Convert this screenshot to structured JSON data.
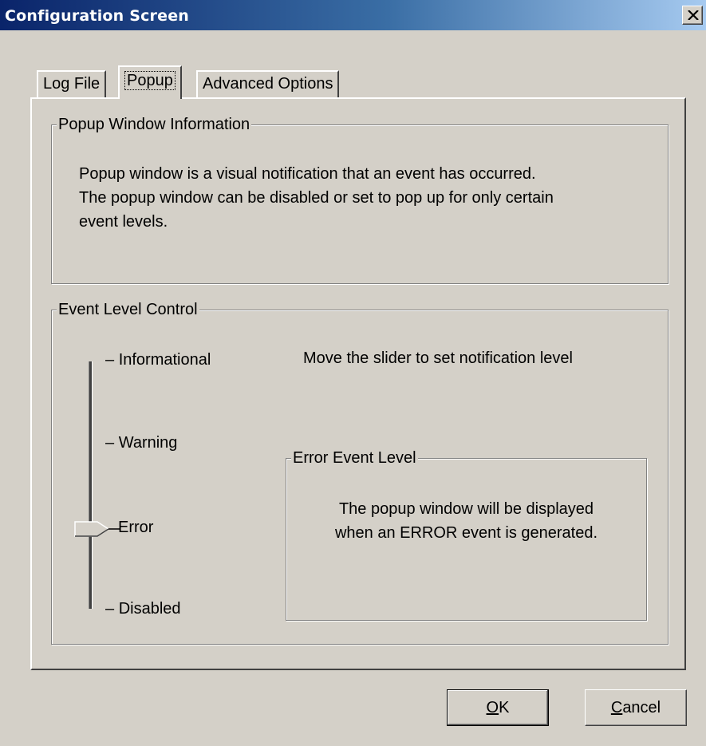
{
  "window": {
    "title": "Configuration Screen",
    "close_icon": "close-icon"
  },
  "tabs": [
    {
      "label": "Log File",
      "active": false
    },
    {
      "label": "Popup",
      "active": true
    },
    {
      "label": "Advanced Options",
      "active": false
    }
  ],
  "popup_info": {
    "group_label": "Popup Window Information",
    "lines": [
      "Popup window is a visual notification that an event has occurred.",
      "The popup window can be disabled or set to pop up for only certain",
      "event levels."
    ]
  },
  "event_control": {
    "group_label": "Event Level Control",
    "instruction": "Move the slider to set notification level",
    "levels": [
      "Informational",
      "Warning",
      "Error",
      "Disabled"
    ],
    "selected_level": "Error",
    "tick_prefix": "–"
  },
  "error_level": {
    "group_label": "Error Event Level",
    "lines": [
      "The popup window will be displayed",
      "when an ERROR event is generated."
    ]
  },
  "buttons": {
    "ok": {
      "mnemonic": "O",
      "rest": "K"
    },
    "cancel": {
      "mnemonic": "C",
      "rest": "ancel"
    }
  }
}
